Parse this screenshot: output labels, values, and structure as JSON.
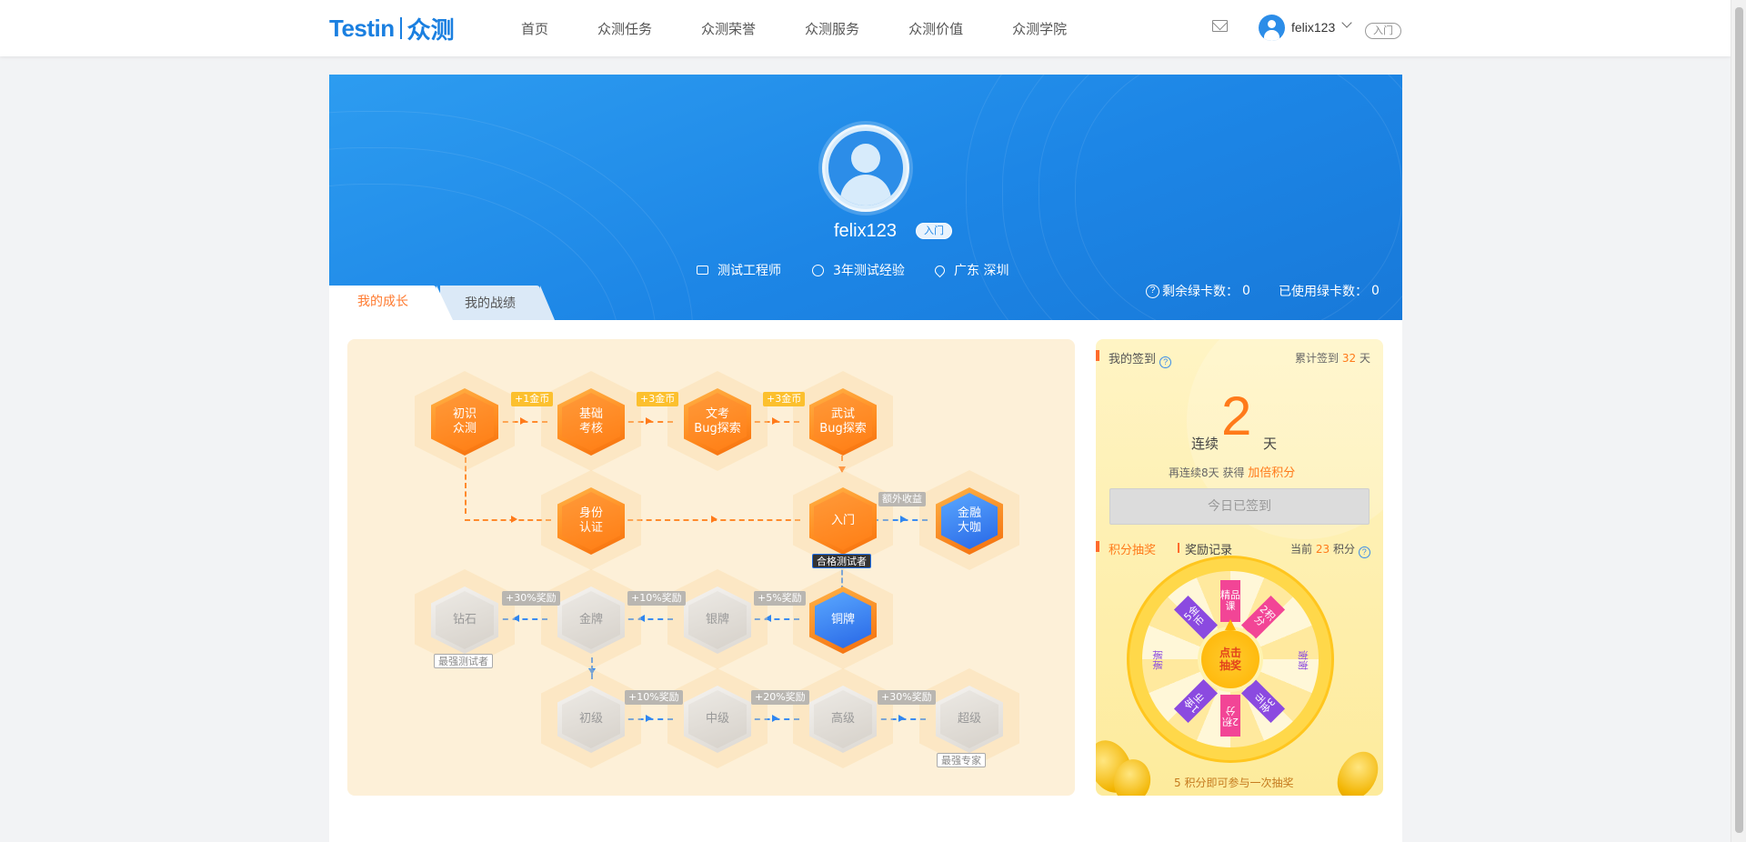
{
  "header": {
    "logo_en": "Testin",
    "logo_cn": "众测",
    "nav": [
      "首页",
      "众测任务",
      "众测荣誉",
      "众测服务",
      "众测价值",
      "众测学院"
    ],
    "username": "felix123",
    "level": "入门"
  },
  "profile": {
    "name": "felix123",
    "level": "入门",
    "role": "测试工程师",
    "experience": "3年测试经验",
    "location": "广东 深圳",
    "remaining_cards_label": "剩余绿卡数：",
    "remaining_cards": "0",
    "used_cards_label": "已使用绿卡数：",
    "used_cards": "0"
  },
  "tabs": {
    "growth": "我的成长",
    "record": "我的战绩"
  },
  "growth": {
    "row1": [
      {
        "label": [
          "初识",
          "众测"
        ]
      },
      {
        "label": [
          "基础",
          "考核"
        ]
      },
      {
        "label": [
          "文考",
          "Bug探索"
        ]
      },
      {
        "label": [
          "武试",
          "Bug探索"
        ]
      }
    ],
    "row1_rewards": [
      "+1金币",
      "+3金币",
      "+3金币"
    ],
    "row2": [
      {
        "label": [
          "身份",
          "认证"
        ]
      },
      {
        "label": [
          "入门"
        ]
      },
      {
        "label": [
          "金融",
          "大咖"
        ]
      }
    ],
    "extra_income": "额外收益",
    "qualified": "合格测试者",
    "row3": [
      {
        "label": [
          "钻石"
        ]
      },
      {
        "label": [
          "金牌"
        ]
      },
      {
        "label": [
          "银牌"
        ]
      },
      {
        "label": [
          "铜牌"
        ]
      }
    ],
    "row3_rewards": [
      "+30%奖励",
      "+10%奖励",
      "+5%奖励"
    ],
    "strongest_tester": "最强测试者",
    "row4": [
      {
        "label": [
          "初级"
        ]
      },
      {
        "label": [
          "中级"
        ]
      },
      {
        "label": [
          "高级"
        ]
      },
      {
        "label": [
          "超级"
        ]
      }
    ],
    "row4_rewards": [
      "+10%奖励",
      "+20%奖励",
      "+30%奖励"
    ],
    "strongest_expert": "最强专家"
  },
  "signin": {
    "title": "我的签到",
    "total_prefix": "累计签到",
    "total_days": "32",
    "total_suffix": "天",
    "streak_prefix": "连续",
    "streak_days": "2",
    "streak_suffix": "天",
    "hint_prefix": "再连续8天 获得",
    "hint_bonus": "加倍积分",
    "button": "今日已签到",
    "lottery_tab": "积分抽奖",
    "record_tab": "奖励记录",
    "current_prefix": "当前",
    "current_points": "23",
    "current_suffix": "积分",
    "wheel_center": [
      "点击",
      "抽奖"
    ],
    "prizes": [
      "精品课",
      "2积分",
      "3金币",
      "2积分",
      "1金币",
      "5金币"
    ],
    "prize_plain": [
      "谢谢",
      "谢谢"
    ],
    "footer": "5 积分即可参与一次抽奖"
  },
  "colors": {
    "brand": "#1a7fe0",
    "accent": "#ff7a1a",
    "banner": "#1d86e6"
  }
}
